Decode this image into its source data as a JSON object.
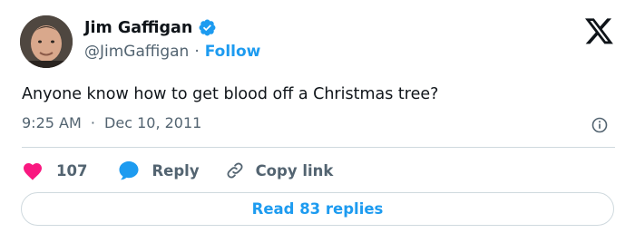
{
  "author": {
    "name": "Jim Gaffigan",
    "handle": "@JimGaffigan",
    "separator": "·",
    "follow_label": "Follow",
    "verified_icon": "verified-badge-icon"
  },
  "tweet": {
    "text": "Anyone know how to get blood off a Christmas tree?",
    "time": "9:25 AM",
    "separator": "·",
    "date": "Dec 10, 2011"
  },
  "actions": {
    "like_count": "107",
    "reply_label": "Reply",
    "copy_link_label": "Copy link"
  },
  "footer": {
    "read_replies_label": "Read 83 replies"
  },
  "colors": {
    "accent": "#1d9bf0",
    "like": "#f91880",
    "text": "#0f1419",
    "muted": "#536471",
    "border": "#cfd9de"
  },
  "icons": [
    "x-logo-icon",
    "verified-badge-icon",
    "info-icon",
    "heart-icon",
    "reply-bubble-icon",
    "link-icon"
  ]
}
